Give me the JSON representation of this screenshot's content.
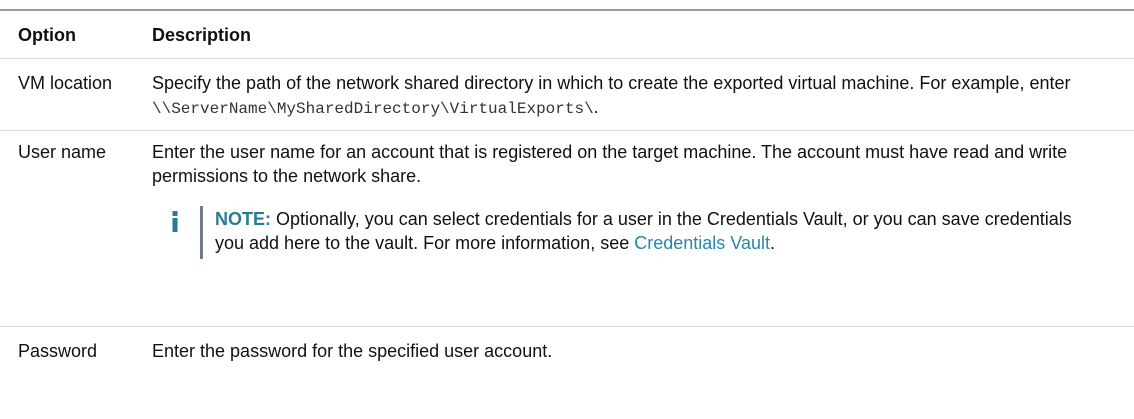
{
  "header": {
    "option": "Option",
    "description": "Description"
  },
  "rows": [
    {
      "option": "VM location",
      "desc_prefix": "Specify the path of the network shared directory in which to create the exported virtual machine. For example, enter ",
      "desc_path": "\\\\ServerName\\MySharedDirectory\\VirtualExports\\",
      "desc_suffix": "."
    },
    {
      "option": "User name",
      "desc": "Enter the user name for an account that is registered on the target machine. The account must have read and write permissions to the network share.",
      "note": {
        "icon": "info-icon",
        "label": "NOTE:",
        "text": " Optionally, you can select credentials for a user in the Credentials Vault, or you can save credentials you add here to the vault. For more information, see ",
        "link": "Credentials Vault",
        "suffix": "."
      }
    },
    {
      "option": "Password",
      "desc": "Enter the password for the specified user account."
    }
  ],
  "colors": {
    "note_label": "#2a7a94",
    "link": "#2a86a8",
    "note_bar": "#6b7d8a",
    "info_icon": "#2a7a94"
  }
}
